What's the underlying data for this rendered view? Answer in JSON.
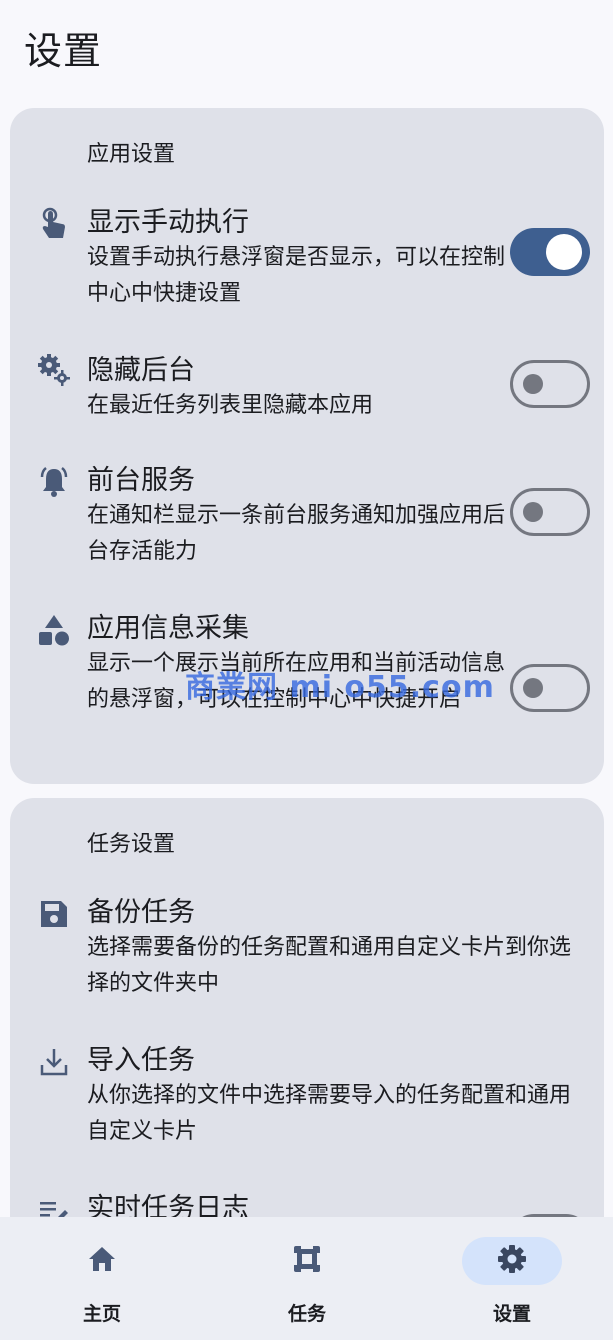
{
  "page": {
    "title": "设置"
  },
  "app_settings": {
    "section_title": "应用设置",
    "items": [
      {
        "title": "显示手动执行",
        "desc": "设置手动执行悬浮窗是否显示，可以在控制中心中快捷设置",
        "icon": "touch-icon",
        "switch": "on"
      },
      {
        "title": "隐藏后台",
        "desc": "在最近任务列表里隐藏本应用",
        "icon": "gears-icon",
        "switch": "off"
      },
      {
        "title": "前台服务",
        "desc": "在通知栏显示一条前台服务通知加强应用后台存活能力",
        "icon": "bell-icon",
        "switch": "off"
      },
      {
        "title": "应用信息采集",
        "desc": "显示一个展示当前所在应用和当前活动信息的悬浮窗，可以在控制中心中快捷开启",
        "icon": "shapes-icon",
        "switch": "off"
      }
    ]
  },
  "task_settings": {
    "section_title": "任务设置",
    "items": [
      {
        "title": "备份任务",
        "desc": "选择需要备份的任务配置和通用自定义卡片到你选择的文件夹中",
        "icon": "save-icon"
      },
      {
        "title": "导入任务",
        "desc": "从你选择的文件中选择需要导入的任务配置和通用自定义卡片",
        "icon": "download-icon"
      },
      {
        "title": "实时任务日志",
        "icon": "edit-note-icon"
      }
    ]
  },
  "watermark": "商業网 mi o55.com",
  "bottom_nav": {
    "items": [
      {
        "label": "主页",
        "icon": "home-icon",
        "active": false
      },
      {
        "label": "任务",
        "icon": "task-icon",
        "active": false
      },
      {
        "label": "设置",
        "icon": "gear-icon",
        "active": true
      }
    ]
  },
  "colors": {
    "accent": "#3e5f90",
    "card": "#dfe1e9",
    "icon": "#4a5a78",
    "nav_active": "#d4e3fb"
  }
}
